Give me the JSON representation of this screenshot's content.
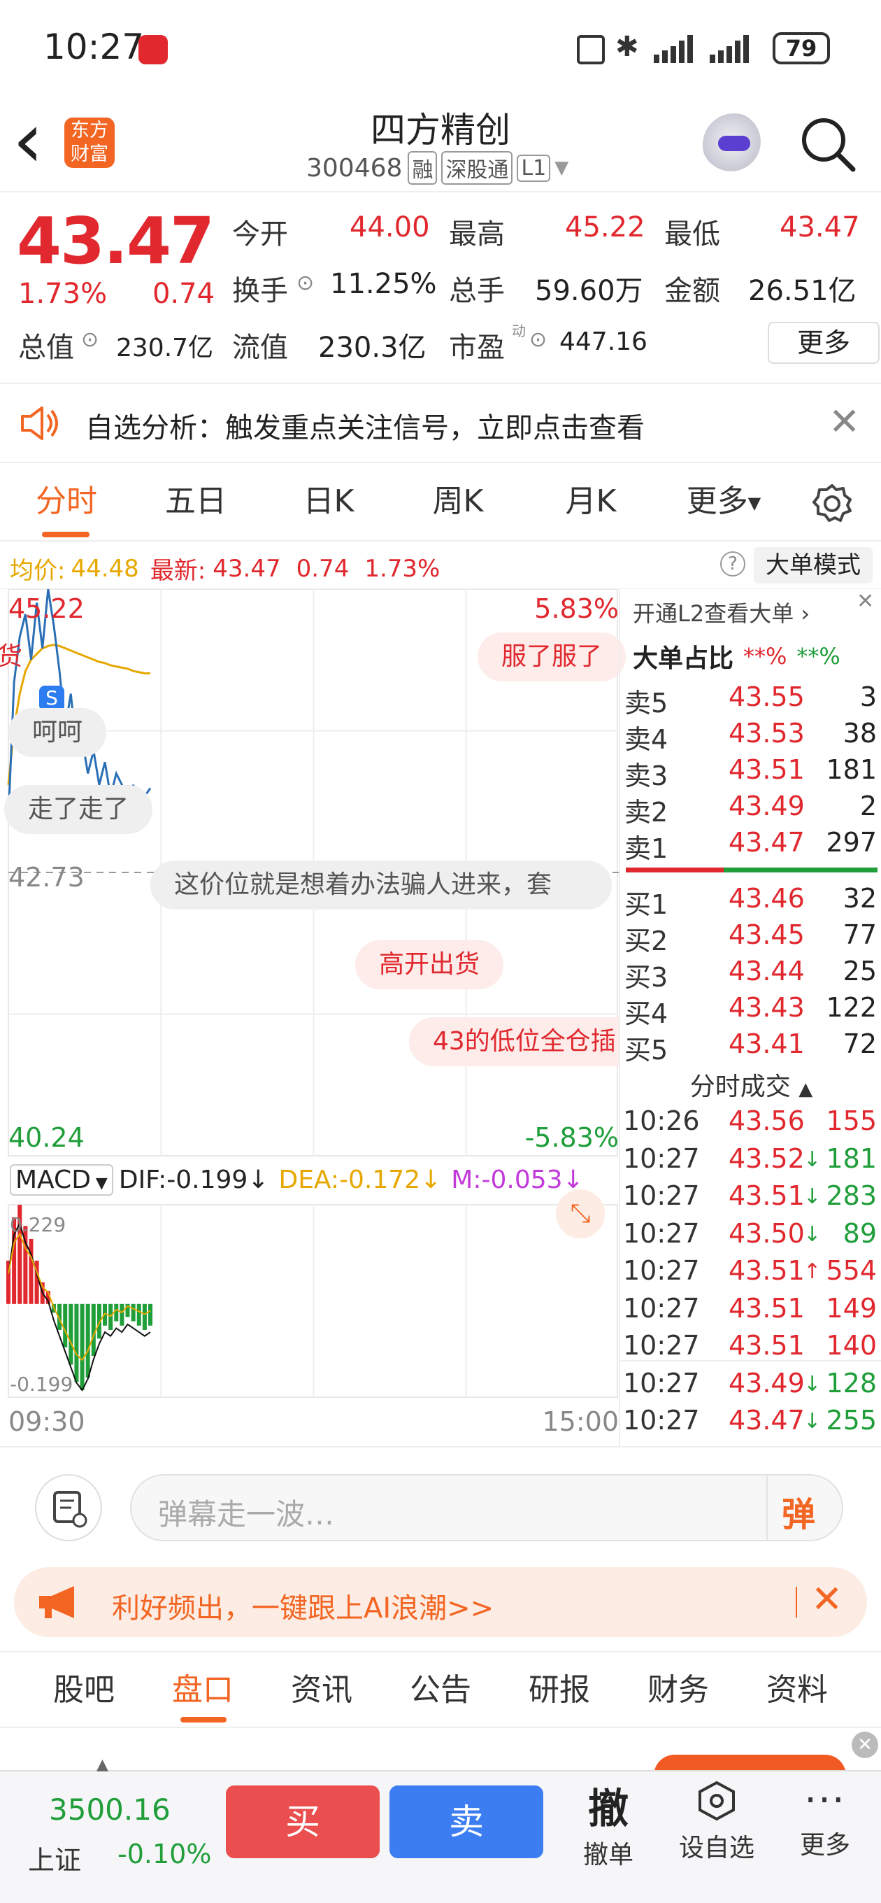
{
  "status_bar": {
    "time": "10:27",
    "battery": "79"
  },
  "header": {
    "back_label": "‹",
    "logo_text_1": "东方",
    "logo_text_2": "财富",
    "stock_name": "四方精创",
    "stock_code": "300468",
    "tags": [
      "融",
      "深股通",
      "L1"
    ]
  },
  "quote": {
    "price": "43.47",
    "change_pct": "1.73%",
    "change_abs": "0.74",
    "open_label": "今开",
    "open": "44.00",
    "high_label": "最高",
    "high": "45.22",
    "low_label": "最低",
    "low": "43.47",
    "turnover_label": "换手",
    "turnover": "11.25%",
    "volume_label": "总手",
    "volume": "59.60万",
    "amount_label": "金额",
    "amount": "26.51亿",
    "mktcap_label": "总值",
    "mktcap": "230.7亿",
    "float_label": "流值",
    "float": "230.3亿",
    "pe_label": "市盈",
    "pe_sup": "动",
    "pe": "447.16",
    "more_label": "更多"
  },
  "notice": {
    "text": "自选分析：触发重点关注信号，立即点击查看"
  },
  "tabs": [
    "分时",
    "五日",
    "日K",
    "周K",
    "月K",
    "更多"
  ],
  "active_tab": 0,
  "chart_info": {
    "avg_label": "均价:",
    "avg": "44.48",
    "latest_label": "最新:",
    "latest": "43.47",
    "chg": "0.74",
    "pct": "1.73%",
    "mode_label": "大单模式"
  },
  "chart_data": {
    "type": "line",
    "y_top": "45.22",
    "y_mid": "42.73",
    "y_bottom": "40.24",
    "pct_top": "5.83%",
    "pct_bottom": "-5.83%",
    "x_start": "09:30",
    "x_end": "15:00",
    "ylim": [
      40.24,
      45.22
    ],
    "price_series": [
      43.2,
      44.4,
      44.8,
      45.0,
      44.6,
      45.1,
      44.7,
      45.22,
      44.9,
      44.5,
      44.0,
      44.3,
      43.8,
      43.9,
      43.6,
      43.8,
      43.5,
      43.7,
      43.4,
      43.6,
      43.5,
      43.3,
      43.5,
      43.2,
      43.4,
      43.47
    ],
    "avg_series": [
      43.5,
      44.0,
      44.3,
      44.5,
      44.6,
      44.65,
      44.7,
      44.72,
      44.73,
      44.72,
      44.7,
      44.68,
      44.66,
      44.64,
      44.62,
      44.6,
      44.58,
      44.57,
      44.55,
      44.54,
      44.53,
      44.52,
      44.5,
      44.49,
      44.48,
      44.48
    ],
    "macd": {
      "label": "MACD",
      "dif_label": "DIF:",
      "dif": "-0.199",
      "dea_label": "DEA:",
      "dea": "-0.172",
      "m_label": "M:",
      "m": "-0.053",
      "top": "0.229",
      "bottom": "-0.199",
      "bars": [
        0.1,
        0.2,
        0.229,
        0.18,
        0.15,
        0.1,
        0.05,
        0.03,
        -0.02,
        -0.06,
        -0.1,
        -0.14,
        -0.18,
        -0.199,
        -0.17,
        -0.12,
        -0.08,
        -0.05,
        -0.06,
        -0.04,
        -0.05,
        -0.03,
        -0.04,
        -0.05,
        -0.06,
        -0.05
      ]
    }
  },
  "danmu": [
    "服了服了",
    "呵呵",
    "走了走了",
    "这价位就是想着办法骗人进来，套",
    "高开出货",
    "43的低位全仓插",
    "出货"
  ],
  "order_book": {
    "promo": "开通L2查看大单",
    "big_label": "大单占比",
    "big_red": "**%",
    "big_green": "**%",
    "asks": [
      {
        "label": "卖5",
        "price": "43.55",
        "vol": "3"
      },
      {
        "label": "卖4",
        "price": "43.53",
        "vol": "38"
      },
      {
        "label": "卖3",
        "price": "43.51",
        "vol": "181"
      },
      {
        "label": "卖2",
        "price": "43.49",
        "vol": "2"
      },
      {
        "label": "卖1",
        "price": "43.47",
        "vol": "297"
      }
    ],
    "bids": [
      {
        "label": "买1",
        "price": "43.46",
        "vol": "32"
      },
      {
        "label": "买2",
        "price": "43.45",
        "vol": "77"
      },
      {
        "label": "买3",
        "price": "43.44",
        "vol": "25"
      },
      {
        "label": "买4",
        "price": "43.43",
        "vol": "122"
      },
      {
        "label": "买5",
        "price": "43.41",
        "vol": "72"
      }
    ],
    "trades_label": "分时成交",
    "trades": [
      {
        "time": "10:26",
        "price": "43.56",
        "arrow": "",
        "vol": "155",
        "color": "red"
      },
      {
        "time": "10:27",
        "price": "43.52",
        "arrow": "↓",
        "vol": "181",
        "color": "green"
      },
      {
        "time": "10:27",
        "price": "43.51",
        "arrow": "↓",
        "vol": "283",
        "color": "green"
      },
      {
        "time": "10:27",
        "price": "43.50",
        "arrow": "↓",
        "vol": "89",
        "color": "green"
      },
      {
        "time": "10:27",
        "price": "43.51",
        "arrow": "↑",
        "vol": "554",
        "color": "red"
      },
      {
        "time": "10:27",
        "price": "43.51",
        "arrow": "",
        "vol": "149",
        "color": "red"
      },
      {
        "time": "10:27",
        "price": "43.51",
        "arrow": "",
        "vol": "140",
        "color": "red"
      },
      {
        "time": "10:27",
        "price": "43.49",
        "arrow": "↓",
        "vol": "128",
        "color": "green"
      },
      {
        "time": "10:27",
        "price": "43.47",
        "arrow": "↓",
        "vol": "255",
        "color": "green"
      }
    ]
  },
  "input_bar": {
    "placeholder": "弹幕走一波…",
    "send_label": "弹"
  },
  "banner": {
    "text": "利好频出，一键跟上AI浪潮>>"
  },
  "bottom_tabs": [
    "股吧",
    "盘口",
    "资讯",
    "公告",
    "研报",
    "财务",
    "资料"
  ],
  "active_bottom_tab": 1,
  "footer": {
    "index_value": "3500.16",
    "index_name": "上证",
    "index_pct": "-0.10%",
    "buy_label": "买",
    "sell_label": "卖",
    "cancel_glyph": "撤",
    "cancel_label": "撤单",
    "watch_label": "设自选",
    "more_label": "更多"
  },
  "colors": {
    "red": "#e0282e",
    "green": "#1f9e3a",
    "accent": "#f26522",
    "blue": "#2d7cf0"
  }
}
